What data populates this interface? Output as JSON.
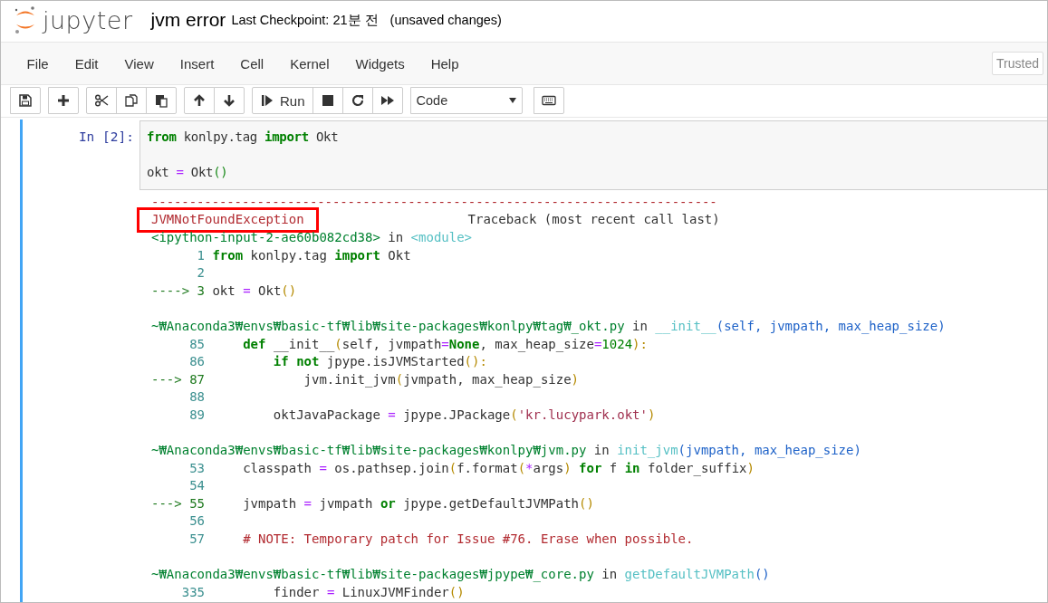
{
  "header": {
    "logo_text": "jupyter",
    "title": "jvm error",
    "checkpoint": "Last Checkpoint: 21분 전",
    "save_status": "(unsaved changes)"
  },
  "menu": {
    "items": [
      "File",
      "Edit",
      "View",
      "Insert",
      "Cell",
      "Kernel",
      "Widgets",
      "Help"
    ],
    "trusted": "Trusted"
  },
  "toolbar": {
    "groups": [
      {
        "buttons": [
          {
            "kind": "save"
          }
        ]
      },
      {
        "buttons": [
          {
            "kind": "add"
          }
        ]
      },
      {
        "buttons": [
          {
            "kind": "cut"
          },
          {
            "kind": "copy"
          },
          {
            "kind": "paste"
          }
        ]
      },
      {
        "buttons": [
          {
            "kind": "up"
          },
          {
            "kind": "down"
          }
        ]
      },
      {
        "buttons": [
          {
            "kind": "run",
            "label": "Run"
          },
          {
            "kind": "stop"
          },
          {
            "kind": "restart"
          },
          {
            "kind": "run-all"
          }
        ]
      },
      {
        "buttons": [
          {
            "kind": "cell-type",
            "label": "Code"
          }
        ]
      },
      {
        "buttons": [
          {
            "kind": "keyboard"
          }
        ]
      }
    ]
  },
  "cell": {
    "selected": true,
    "prompt": "In [2]:",
    "input": [
      {
        "kind": "kw",
        "text": "from"
      },
      {
        "kind": "plain",
        "text": " konlpy.tag "
      },
      {
        "kind": "kw",
        "text": "import"
      },
      {
        "kind": "plain",
        "text": " Okt\n\nokt "
      },
      {
        "kind": "op",
        "text": "="
      },
      {
        "kind": "plain",
        "text": " Okt"
      },
      {
        "kind": "paren",
        "text": "()"
      }
    ],
    "output": {
      "rule": "---------------------------------------------------------------------------",
      "exception": {
        "name": "JVMNotFoundException",
        "highlighted": true
      },
      "traceback_label": "Traceback (most recent call last)",
      "frames": [
        [
          {
            "kind": "path",
            "text": "<ipython-input-2-ae60b082cd38>"
          },
          {
            "kind": "plain",
            "text": " in "
          },
          {
            "kind": "module",
            "text": "<module>"
          },
          {
            "kind": "lineno",
            "text": "\n      1 "
          },
          {
            "kind": "kw",
            "text": "from"
          },
          {
            "kind": "plain",
            "text": " konlpy.tag "
          },
          {
            "kind": "kw",
            "text": "import"
          },
          {
            "kind": "plain",
            "text": " Okt"
          },
          {
            "kind": "lineno",
            "text": "\n      2\n"
          },
          {
            "kind": "arrow",
            "text": "----> 3 "
          },
          {
            "kind": "plain",
            "text": "okt "
          },
          {
            "kind": "op",
            "text": "="
          },
          {
            "kind": "plain",
            "text": " Okt"
          },
          {
            "kind": "paren",
            "text": "()"
          }
        ],
        [
          {
            "kind": "path",
            "text": "~₩Anaconda3₩envs₩basic-tf₩lib₩site-packages₩konlpy₩tag₩_okt.py"
          },
          {
            "kind": "plain",
            "text": " in "
          },
          {
            "kind": "module",
            "text": "__init__"
          },
          {
            "kind": "args",
            "text": "(self, jvmpath, max_heap_size)"
          },
          {
            "kind": "lineno",
            "text": "\n     85     "
          },
          {
            "kind": "kw",
            "text": "def"
          },
          {
            "kind": "plain",
            "text": " __init__"
          },
          {
            "kind": "paren",
            "text": "("
          },
          {
            "kind": "plain",
            "text": "self, jvmpath"
          },
          {
            "kind": "op",
            "text": "="
          },
          {
            "kind": "kw",
            "text": "None"
          },
          {
            "kind": "plain",
            "text": ", max_heap_size"
          },
          {
            "kind": "op",
            "text": "="
          },
          {
            "kind": "num",
            "text": "1024"
          },
          {
            "kind": "paren",
            "text": "):"
          },
          {
            "kind": "lineno",
            "text": "\n     86         "
          },
          {
            "kind": "kw",
            "text": "if"
          },
          {
            "kind": "kw",
            "text": " not"
          },
          {
            "kind": "plain",
            "text": " jpype.isJVMStarted"
          },
          {
            "kind": "paren",
            "text": "():"
          },
          {
            "kind": "arrow",
            "text": "\n---> 87 "
          },
          {
            "kind": "plain",
            "text": "            jvm.init_jvm"
          },
          {
            "kind": "paren",
            "text": "("
          },
          {
            "kind": "plain",
            "text": "jvmpath, max_heap_size"
          },
          {
            "kind": "paren",
            "text": ")"
          },
          {
            "kind": "lineno",
            "text": "\n     88\n     89 "
          },
          {
            "kind": "plain",
            "text": "        oktJavaPackage "
          },
          {
            "kind": "op",
            "text": "="
          },
          {
            "kind": "plain",
            "text": " jpype.JPackage"
          },
          {
            "kind": "paren",
            "text": "("
          },
          {
            "kind": "str",
            "text": "'kr.lucypark.okt'"
          },
          {
            "kind": "paren",
            "text": ")"
          }
        ],
        [
          {
            "kind": "path",
            "text": "~₩Anaconda3₩envs₩basic-tf₩lib₩site-packages₩konlpy₩jvm.py"
          },
          {
            "kind": "plain",
            "text": " in "
          },
          {
            "kind": "module",
            "text": "init_jvm"
          },
          {
            "kind": "args",
            "text": "(jvmpath, max_heap_size)"
          },
          {
            "kind": "lineno",
            "text": "\n     53 "
          },
          {
            "kind": "plain",
            "text": "    classpath "
          },
          {
            "kind": "op",
            "text": "="
          },
          {
            "kind": "plain",
            "text": " os.pathsep.join"
          },
          {
            "kind": "paren",
            "text": "("
          },
          {
            "kind": "plain",
            "text": "f.format"
          },
          {
            "kind": "paren",
            "text": "("
          },
          {
            "kind": "op",
            "text": "*"
          },
          {
            "kind": "plain",
            "text": "args"
          },
          {
            "kind": "paren",
            "text": ")"
          },
          {
            "kind": "kw",
            "text": " for"
          },
          {
            "kind": "plain",
            "text": " f "
          },
          {
            "kind": "kw",
            "text": "in"
          },
          {
            "kind": "plain",
            "text": " folder_suffix"
          },
          {
            "kind": "paren",
            "text": ")"
          },
          {
            "kind": "lineno",
            "text": "\n     54\n"
          },
          {
            "kind": "arrow",
            "text": "---> 55 "
          },
          {
            "kind": "plain",
            "text": "    jvmpath "
          },
          {
            "kind": "op",
            "text": "="
          },
          {
            "kind": "plain",
            "text": " jvmpath "
          },
          {
            "kind": "kw",
            "text": "or"
          },
          {
            "kind": "plain",
            "text": " jpype.getDefaultJVMPath"
          },
          {
            "kind": "paren",
            "text": "()"
          },
          {
            "kind": "lineno",
            "text": "\n     56\n     57     "
          },
          {
            "kind": "comment",
            "text": "# NOTE: Temporary patch for Issue #76. Erase when possible."
          }
        ],
        [
          {
            "kind": "path",
            "text": "~₩Anaconda3₩envs₩basic-tf₩lib₩site-packages₩jpype₩_core.py"
          },
          {
            "kind": "plain",
            "text": " in "
          },
          {
            "kind": "module",
            "text": "getDefaultJVMPath"
          },
          {
            "kind": "args",
            "text": "()"
          },
          {
            "kind": "lineno",
            "text": "\n    335 "
          },
          {
            "kind": "plain",
            "text": "        finder "
          },
          {
            "kind": "op",
            "text": "="
          },
          {
            "kind": "plain",
            "text": " LinuxJVMFinder"
          },
          {
            "kind": "paren",
            "text": "()"
          }
        ]
      ]
    }
  }
}
